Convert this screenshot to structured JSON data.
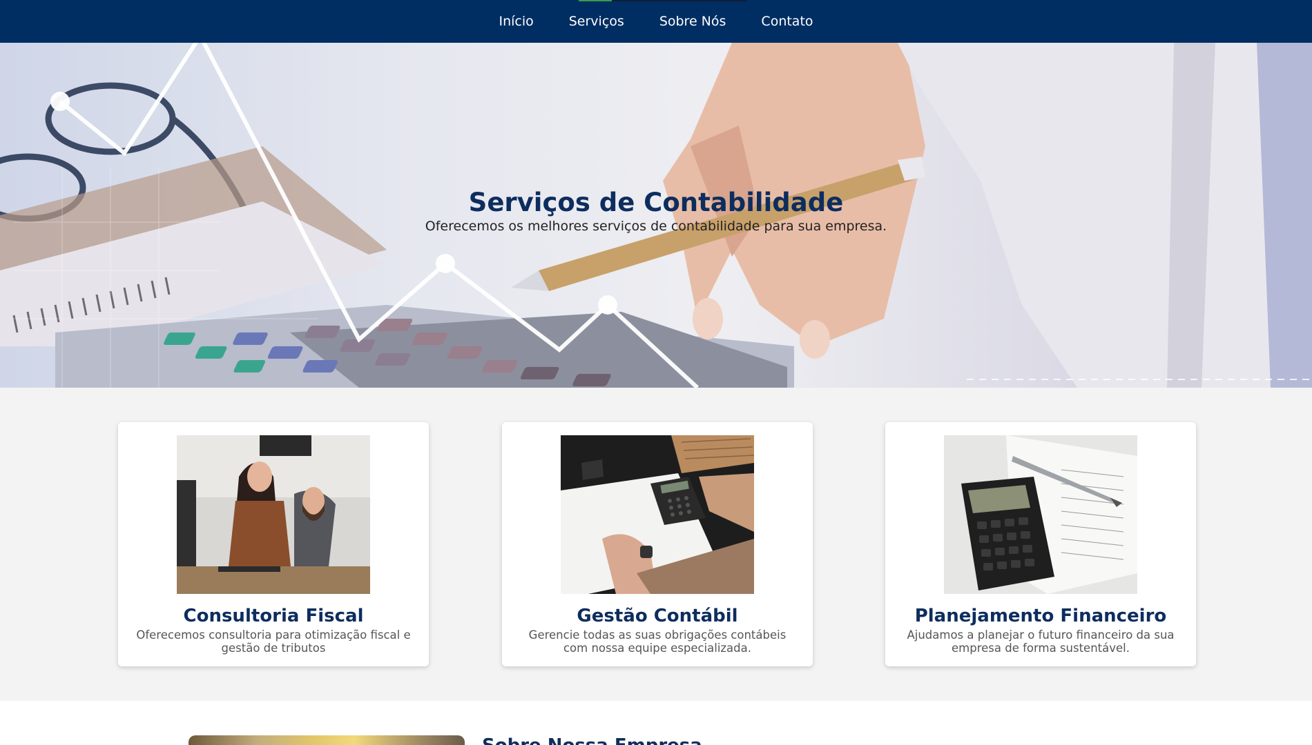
{
  "nav": {
    "items": [
      {
        "label": "Início"
      },
      {
        "label": "Serviços"
      },
      {
        "label": "Sobre Nós"
      },
      {
        "label": "Contato"
      }
    ]
  },
  "hero": {
    "title": "Serviços de Contabilidade",
    "subtitle": "Oferecemos os melhores serviços de contabilidade para sua empresa."
  },
  "services": [
    {
      "title": "Consultoria Fiscal",
      "text": "Oferecemos consultoria para otimização fiscal e gestão de tributos"
    },
    {
      "title": "Gestão Contábil",
      "text": "Gerencie todas as suas obrigações contábeis com nossa equipe especializada."
    },
    {
      "title": "Planejamento Financeiro",
      "text": "Ajudamos a planejar o futuro financeiro da sua empresa de forma sustentável."
    }
  ],
  "about": {
    "title": "Sobre Nossa Empresa"
  },
  "colors": {
    "nav_bg": "#002e63",
    "heading": "#0d2d5e",
    "page_bg": "#f3f3f3"
  }
}
